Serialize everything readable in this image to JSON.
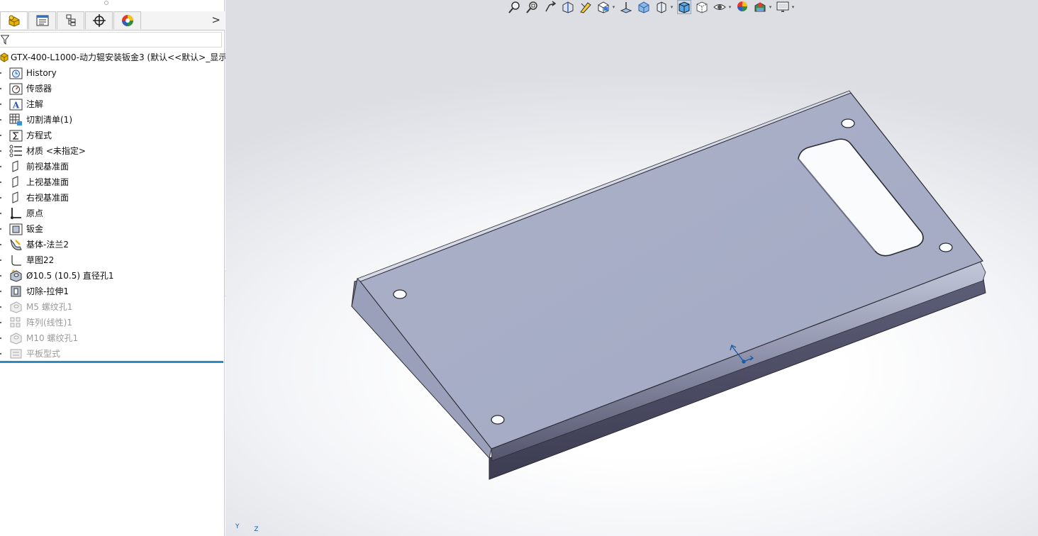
{
  "panel": {
    "tabs": [
      {
        "name": "featuremanager-tab",
        "icon": "part-icon"
      },
      {
        "name": "propertymanager-tab",
        "icon": "property-icon"
      },
      {
        "name": "configurationmanager-tab",
        "icon": "configuration-icon"
      },
      {
        "name": "dimxpertmanager-tab",
        "icon": "crosshair-icon"
      },
      {
        "name": "displaymanager-tab",
        "icon": "appearance-icon"
      }
    ],
    "expand_glyph": ">",
    "root": "GTX-400-L1000-动力辊安装钣金3  (默认<<默认>_显示",
    "items": [
      {
        "label": "History",
        "icon": "history-icon",
        "suppressed": false
      },
      {
        "label": "传感器",
        "icon": "sensor-icon",
        "suppressed": false
      },
      {
        "label": "注解",
        "icon": "annotation-icon",
        "suppressed": false
      },
      {
        "label": "切割清单(1)",
        "icon": "cut-list-icon",
        "suppressed": false
      },
      {
        "label": "方程式",
        "icon": "equation-icon",
        "suppressed": false
      },
      {
        "label": "材质 <未指定>",
        "icon": "material-icon",
        "suppressed": false
      },
      {
        "label": "前视基准面",
        "icon": "plane-icon",
        "suppressed": false
      },
      {
        "label": "上视基准面",
        "icon": "plane-icon",
        "suppressed": false
      },
      {
        "label": "右视基准面",
        "icon": "plane-icon",
        "suppressed": false
      },
      {
        "label": "原点",
        "icon": "origin-icon",
        "suppressed": false
      },
      {
        "label": "钣金",
        "icon": "sheet-metal-icon",
        "suppressed": false
      },
      {
        "label": "基体-法兰2",
        "icon": "base-flange-icon",
        "suppressed": false
      },
      {
        "label": "草图22",
        "icon": "sketch-icon",
        "suppressed": false
      },
      {
        "label": "Ø10.5 (10.5) 直径孔1",
        "icon": "hole-wizard-icon",
        "suppressed": false
      },
      {
        "label": "切除-拉伸1",
        "icon": "extruded-cut-icon",
        "suppressed": false
      },
      {
        "label": "M5 螺纹孔1",
        "icon": "hole-wizard-icon",
        "suppressed": true
      },
      {
        "label": "阵列(线性)1",
        "icon": "linear-pattern-icon",
        "suppressed": true
      },
      {
        "label": "M10 螺纹孔1",
        "icon": "hole-wizard-icon",
        "suppressed": true
      },
      {
        "label": "平板型式",
        "icon": "flat-pattern-icon",
        "suppressed": true
      }
    ]
  },
  "view_toolbar": [
    {
      "name": "zoom-to-fit-icon"
    },
    {
      "name": "zoom-to-area-icon"
    },
    {
      "name": "previous-view-icon"
    },
    {
      "name": "section-view-icon"
    },
    {
      "name": "dynamic-annotation-icon"
    },
    {
      "name": "view-orientation-icon",
      "dropdown": true
    },
    {
      "name": "display-style-icon"
    },
    {
      "name": "hide-show-items-icon"
    },
    {
      "name": "edit-appearance-icon",
      "dropdown": true
    },
    {
      "name": "shaded-with-edges-icon",
      "selected": true
    },
    {
      "name": "hidden-lines-icon"
    },
    {
      "name": "view-settings-icon",
      "dropdown": true
    },
    {
      "name": "apply-scene-icon"
    },
    {
      "name": "scene-icon",
      "dropdown": true
    },
    {
      "name": "monitor-icon",
      "dropdown": true
    }
  ],
  "triad": {
    "y": "Y",
    "z": "Z"
  },
  "colors": {
    "part_top": "#a9b0c8",
    "part_edge": "#2b2b35",
    "part_dark": "#4a4a62",
    "rollback": "#2b8cc4",
    "accent_blue": "#1a5ca8"
  }
}
